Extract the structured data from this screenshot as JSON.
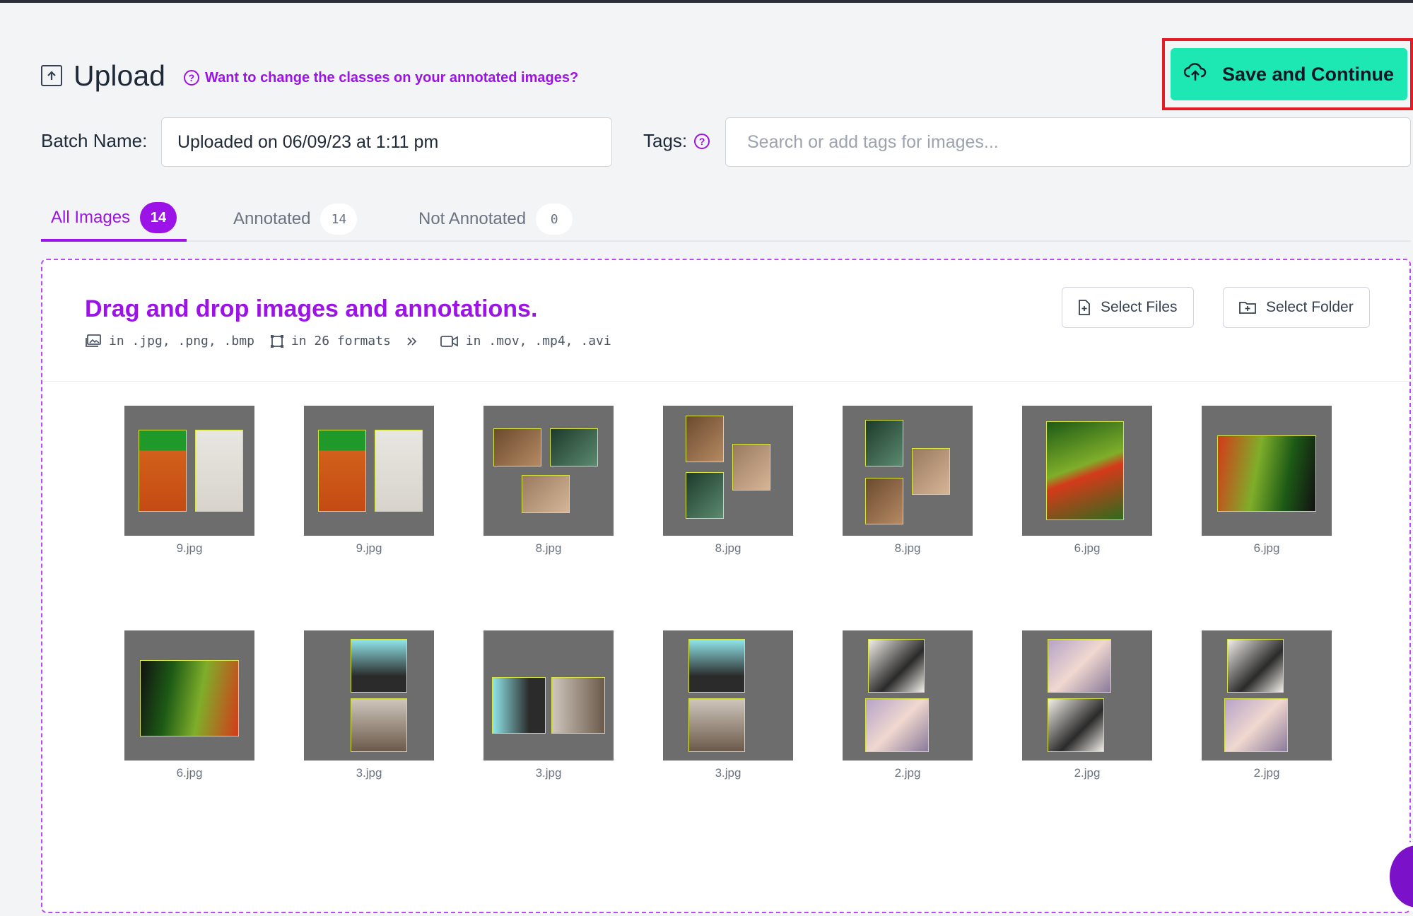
{
  "header": {
    "title": "Upload",
    "help_link": "Want to change the classes on your annotated images?",
    "save_label": "Save and Continue"
  },
  "batch": {
    "label": "Batch Name:",
    "value": "Uploaded on 06/09/23 at 1:11 pm"
  },
  "tags": {
    "label": "Tags:",
    "placeholder": "Search or add tags for images..."
  },
  "tabs": [
    {
      "label": "All Images",
      "count": "14"
    },
    {
      "label": "Annotated",
      "count": "14"
    },
    {
      "label": "Not Annotated",
      "count": "0"
    }
  ],
  "dropzone": {
    "title": "Drag and drop images and annotations.",
    "images_formats": "in .jpg, .png, .bmp",
    "annotation_formats": "in 26 formats",
    "video_formats": "in .mov, .mp4, .avi",
    "select_files": "Select Files",
    "select_folder": "Select Folder"
  },
  "thumbnails": [
    {
      "name": "9.jpg"
    },
    {
      "name": "9.jpg"
    },
    {
      "name": "8.jpg"
    },
    {
      "name": "8.jpg"
    },
    {
      "name": "8.jpg"
    },
    {
      "name": "6.jpg"
    },
    {
      "name": "6.jpg"
    },
    {
      "name": "6.jpg"
    },
    {
      "name": "3.jpg"
    },
    {
      "name": "3.jpg"
    },
    {
      "name": "3.jpg"
    },
    {
      "name": "2.jpg"
    },
    {
      "name": "2.jpg"
    },
    {
      "name": "2.jpg"
    }
  ],
  "colors": {
    "accent": "#9b13e6",
    "save_button": "#1de7b3",
    "highlight_border": "#e31b23",
    "thumb_bg": "#6d6d6d"
  },
  "icons": [
    "upload-icon",
    "help-icon",
    "cloud-upload-icon",
    "image-icon",
    "crop-icon",
    "chevrons-right-icon",
    "video-icon",
    "file-plus-icon",
    "folder-plus-icon",
    "chat-icon"
  ]
}
